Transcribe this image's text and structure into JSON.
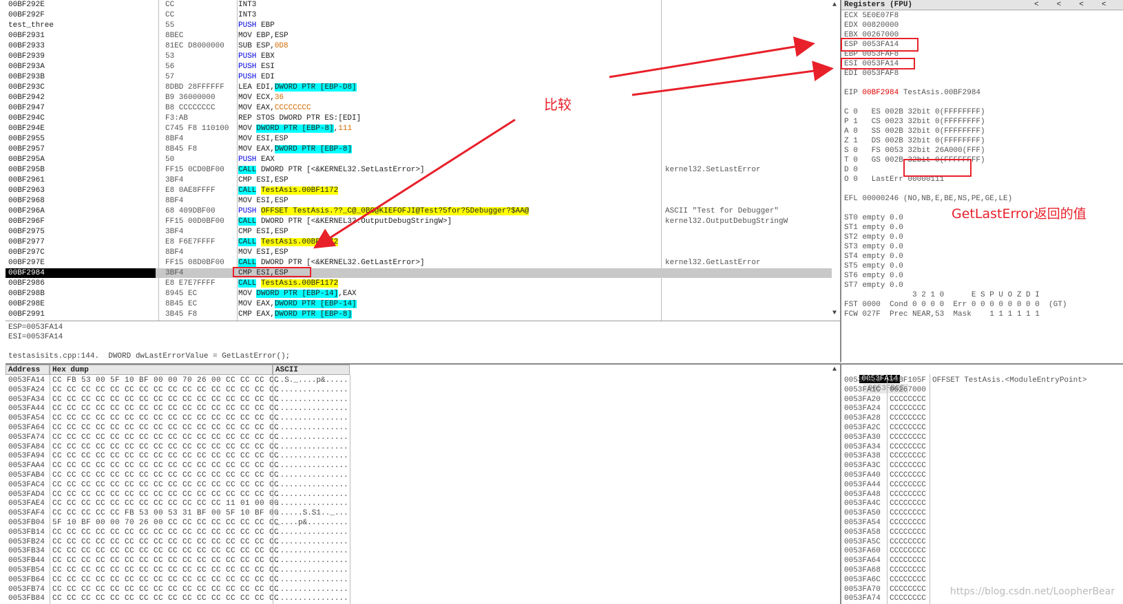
{
  "disasm": {
    "rows": [
      {
        "addr": "00BF292E",
        "hex": "CC",
        "mn": "INT3",
        "ops": ""
      },
      {
        "addr": "00BF292F",
        "hex": "CC",
        "mn": "INT3",
        "ops": ""
      },
      {
        "addr": "test_three",
        "hex": "55",
        "mn": "PUSH",
        "ops": " EBP",
        "mnClass": "mn-blue"
      },
      {
        "addr": "00BF2931",
        "hex": "8BEC",
        "mn": "MOV",
        "ops": " EBP,ESP"
      },
      {
        "addr": "00BF2933",
        "hex": "81EC D8000000",
        "mn": "SUB",
        "ops": " ESP,",
        "num": "0D8"
      },
      {
        "addr": "00BF2939",
        "hex": "53",
        "mn": "PUSH",
        "ops": " EBX",
        "mnClass": "mn-blue"
      },
      {
        "addr": "00BF293A",
        "hex": "56",
        "mn": "PUSH",
        "ops": " ESI",
        "mnClass": "mn-blue"
      },
      {
        "addr": "00BF293B",
        "hex": "57",
        "mn": "PUSH",
        "ops": " EDI",
        "mnClass": "mn-blue"
      },
      {
        "addr": "00BF293C",
        "hex": "8DBD 28FFFFFF",
        "mn": "LEA",
        "ops": " EDI,",
        "hl": "DWORD PTR [EBP-D8]"
      },
      {
        "addr": "00BF2942",
        "hex": "B9 36000000",
        "mn": "MOV",
        "ops": " ECX,",
        "num": "36"
      },
      {
        "addr": "00BF2947",
        "hex": "B8 CCCCCCCC",
        "mn": "MOV",
        "ops": " EAX,",
        "num": "CCCCCCCC"
      },
      {
        "addr": "00BF294C",
        "hex": "F3:AB",
        "mn": "REP STOS",
        "ops": " DWORD PTR ES:[EDI]"
      },
      {
        "addr": "00BF294E",
        "hex": "C745 F8 110100",
        "mn": "MOV",
        "ops": " ",
        "hl": "DWORD PTR [EBP-8]",
        "ops2": ",",
        "num2": "111"
      },
      {
        "addr": "00BF2955",
        "hex": "8BF4",
        "mn": "MOV",
        "ops": " ESI,ESP"
      },
      {
        "addr": "00BF2957",
        "hex": "8B45 F8",
        "mn": "MOV",
        "ops": " EAX,",
        "hl": "DWORD PTR [EBP-8]"
      },
      {
        "addr": "00BF295A",
        "hex": "50",
        "mn": "PUSH",
        "ops": " EAX",
        "mnClass": "mn-blue"
      },
      {
        "addr": "00BF295B",
        "hex": "FF15 0CD0BF00",
        "mn": "CALL",
        "ops": " DWORD PTR [<&KERNEL32.SetLastError>]",
        "mnHl": "hl-cyan",
        "com": "kernel32.SetLastError"
      },
      {
        "addr": "00BF2961",
        "hex": "3BF4",
        "mn": "CMP",
        "ops": " ESI,ESP"
      },
      {
        "addr": "00BF2963",
        "hex": "E8 0AE8FFFF",
        "mn": "CALL",
        "ops": " ",
        "mnHl": "hl-cyan",
        "yl": "TestAsis.00BF1172"
      },
      {
        "addr": "00BF2968",
        "hex": "8BF4",
        "mn": "MOV",
        "ops": " ESI,ESP"
      },
      {
        "addr": "00BF296A",
        "hex": "68 409DBF00",
        "mn": "PUSH",
        "ops": " ",
        "mnClass": "mn-blue",
        "yl": "OFFSET TestAsis.??_C@_0BC@KIEFOFJI@Test?5for?5Debugger?$AA@",
        "com": "ASCII \"Test for Debugger\""
      },
      {
        "addr": "00BF296F",
        "hex": "FF15 00D0BF00",
        "mn": "CALL",
        "ops": " DWORD PTR [<&KERNEL32.OutputDebugStringW>]",
        "mnHl": "hl-cyan",
        "com": "kernel32.OutputDebugStringW"
      },
      {
        "addr": "00BF2975",
        "hex": "3BF4",
        "mn": "CMP",
        "ops": " ESI,ESP"
      },
      {
        "addr": "00BF2977",
        "hex": "E8 F6E7FFFF",
        "mn": "CALL",
        "ops": " ",
        "mnHl": "hl-cyan",
        "yl": "TestAsis.00BF1172"
      },
      {
        "addr": "00BF297C",
        "hex": "8BF4",
        "mn": "MOV",
        "ops": " ESI,ESP"
      },
      {
        "addr": "00BF297E",
        "hex": "FF15 08D0BF00",
        "mn": "CALL",
        "ops": " DWORD PTR [<&KERNEL32.GetLastError>]",
        "mnHl": "hl-cyan",
        "com": "kernel32.GetLastError"
      },
      {
        "addr": "00BF2984",
        "hex": "3BF4",
        "mn": "CMP",
        "ops": " ESI,ESP",
        "sel": true
      },
      {
        "addr": "00BF2986",
        "hex": "E8 E7E7FFFF",
        "mn": "CALL",
        "ops": " ",
        "mnHl": "hl-cyan",
        "yl": "TestAsis.00BF1172"
      },
      {
        "addr": "00BF298B",
        "hex": "8945 EC",
        "mn": "MOV",
        "ops": " ",
        "hl": "DWORD PTR [EBP-14]",
        "ops2": ",EAX"
      },
      {
        "addr": "00BF298E",
        "hex": "8B45 EC",
        "mn": "MOV",
        "ops": " EAX,",
        "hl": "DWORD PTR [EBP-14]"
      },
      {
        "addr": "00BF2991",
        "hex": "3B45 F8",
        "mn": "CMP",
        "ops": " EAX,",
        "hl": "DWORD PTR [EBP-8]"
      }
    ]
  },
  "info": {
    "line1": "ESP=0053FA14",
    "line2": "ESI=0053FA14",
    "line3": "testasisits.cpp:144.  DWORD dwLastErrorValue = GetLastError();"
  },
  "registers": {
    "title": "Registers (FPU)",
    "nav": [
      "<",
      "<",
      "<",
      "<"
    ],
    "lines": [
      "ECX 5E0E07F8",
      "EDX 00820000",
      "EBX 00267000",
      "ESP 0053FA14",
      "EBP 0053FAF8",
      "ESI 0053FA14",
      "EDI 0053FAF8",
      "",
      "EIP ",
      "",
      "C 0   ES 002B 32bit 0(FFFFFFFF)",
      "P 1   CS 0023 32bit 0(FFFFFFFF)",
      "A 0   SS 002B 32bit 0(FFFFFFFF)",
      "Z 1   DS 002B 32bit 0(FFFFFFFF)",
      "S 0   FS 0053 32bit 26A000(FFF)",
      "T 0   GS 002B 32bit 0(FFFFFFFF)",
      "D 0",
      "O 0   LastErr 00000111",
      "",
      "EFL 00000246 (NO,NB,E,BE,NS,PE,GE,LE)",
      "",
      "ST0 empty 0.0",
      "ST1 empty 0.0",
      "ST2 empty 0.0",
      "ST3 empty 0.0",
      "ST4 empty 0.0",
      "ST5 empty 0.0",
      "ST6 empty 0.0",
      "ST7 empty 0.0",
      "               3 2 1 0      E S P U O Z D I",
      "FST 0000  Cond 0 0 0 0  Err 0 0 0 0 0 0 0 0  (GT)",
      "FCW 027F  Prec NEAR,53  Mask    1 1 1 1 1 1"
    ],
    "eip_val": "00BF2984",
    "eip_rest": " TestAsis.00BF2984"
  },
  "annotations": {
    "compare": "比较",
    "lasterr": "GetLastError返回的值"
  },
  "dump": {
    "col_address": "Address",
    "col_hex": "Hex dump",
    "col_ascii": "ASCII",
    "rows": [
      [
        "0053FA14",
        "CC FB 53 00 5F 10 BF 00 00 70 26 00 CC CC CC CC",
        "..S._....p&....."
      ],
      [
        "0053FA24",
        "CC CC CC CC CC CC CC CC CC CC CC CC CC CC CC CC",
        "................"
      ],
      [
        "0053FA34",
        "CC CC CC CC CC CC CC CC CC CC CC CC CC CC CC CC",
        "................"
      ],
      [
        "0053FA44",
        "CC CC CC CC CC CC CC CC CC CC CC CC CC CC CC CC",
        "................"
      ],
      [
        "0053FA54",
        "CC CC CC CC CC CC CC CC CC CC CC CC CC CC CC CC",
        "................"
      ],
      [
        "0053FA64",
        "CC CC CC CC CC CC CC CC CC CC CC CC CC CC CC CC",
        "................"
      ],
      [
        "0053FA74",
        "CC CC CC CC CC CC CC CC CC CC CC CC CC CC CC CC",
        "................"
      ],
      [
        "0053FA84",
        "CC CC CC CC CC CC CC CC CC CC CC CC CC CC CC CC",
        "................"
      ],
      [
        "0053FA94",
        "CC CC CC CC CC CC CC CC CC CC CC CC CC CC CC CC",
        "................"
      ],
      [
        "0053FAA4",
        "CC CC CC CC CC CC CC CC CC CC CC CC CC CC CC CC",
        "................"
      ],
      [
        "0053FAB4",
        "CC CC CC CC CC CC CC CC CC CC CC CC CC CC CC CC",
        "................"
      ],
      [
        "0053FAC4",
        "CC CC CC CC CC CC CC CC CC CC CC CC CC CC CC CC",
        "................"
      ],
      [
        "0053FAD4",
        "CC CC CC CC CC CC CC CC CC CC CC CC CC CC CC CC",
        "................"
      ],
      [
        "0053FAE4",
        "CC CC CC CC CC CC CC CC CC CC CC CC 11 01 00 00",
        "................"
      ],
      [
        "0053FAF4",
        "CC CC CC CC CC FB 53 00 53 31 BF 00 5F 10 BF 00",
        "......S.S1.._..."
      ],
      [
        "0053FB04",
        "5F 10 BF 00 00 70 26 00 CC CC CC CC CC CC CC CC",
        "_....p&........."
      ],
      [
        "0053FB14",
        "CC CC CC CC CC CC CC CC CC CC CC CC CC CC CC CC",
        "................"
      ],
      [
        "0053FB24",
        "CC CC CC CC CC CC CC CC CC CC CC CC CC CC CC CC",
        "................"
      ],
      [
        "0053FB34",
        "CC CC CC CC CC CC CC CC CC CC CC CC CC CC CC CC",
        "................"
      ],
      [
        "0053FB44",
        "CC CC CC CC CC CC CC CC CC CC CC CC CC CC CC CC",
        "................"
      ],
      [
        "0053FB54",
        "CC CC CC CC CC CC CC CC CC CC CC CC CC CC CC CC",
        "................"
      ],
      [
        "0053FB64",
        "CC CC CC CC CC CC CC CC CC CC CC CC CC CC CC CC",
        "................"
      ],
      [
        "0053FB74",
        "CC CC CC CC CC CC CC CC CC CC CC CC CC CC CC CC",
        "................"
      ],
      [
        "0053FB84",
        "CC CC CC CC CC CC CC CC CC CC CC CC CC CC CC CC",
        "................"
      ]
    ]
  },
  "stack": {
    "header_addr": "0053FA14",
    "header_val": "0053FBCC",
    "rows": [
      [
        "0053FA18",
        "00BF105F",
        "OFFSET TestAsis.<ModuleEntryPoint>"
      ],
      [
        "0053FA1C",
        "00267000",
        ""
      ],
      [
        "0053FA20",
        "CCCCCCCC",
        ""
      ],
      [
        "0053FA24",
        "CCCCCCCC",
        ""
      ],
      [
        "0053FA28",
        "CCCCCCCC",
        ""
      ],
      [
        "0053FA2C",
        "CCCCCCCC",
        ""
      ],
      [
        "0053FA30",
        "CCCCCCCC",
        ""
      ],
      [
        "0053FA34",
        "CCCCCCCC",
        ""
      ],
      [
        "0053FA38",
        "CCCCCCCC",
        ""
      ],
      [
        "0053FA3C",
        "CCCCCCCC",
        ""
      ],
      [
        "0053FA40",
        "CCCCCCCC",
        ""
      ],
      [
        "0053FA44",
        "CCCCCCCC",
        ""
      ],
      [
        "0053FA48",
        "CCCCCCCC",
        ""
      ],
      [
        "0053FA4C",
        "CCCCCCCC",
        ""
      ],
      [
        "0053FA50",
        "CCCCCCCC",
        ""
      ],
      [
        "0053FA54",
        "CCCCCCCC",
        ""
      ],
      [
        "0053FA58",
        "CCCCCCCC",
        ""
      ],
      [
        "0053FA5C",
        "CCCCCCCC",
        ""
      ],
      [
        "0053FA60",
        "CCCCCCCC",
        ""
      ],
      [
        "0053FA64",
        "CCCCCCCC",
        ""
      ],
      [
        "0053FA68",
        "CCCCCCCC",
        ""
      ],
      [
        "0053FA6C",
        "CCCCCCCC",
        ""
      ],
      [
        "0053FA70",
        "CCCCCCCC",
        ""
      ],
      [
        "0053FA74",
        "CCCCCCCC",
        ""
      ]
    ]
  },
  "watermark": "https://blog.csdn.net/LoopherBear",
  "colors": {
    "annotation": "#e8202a",
    "cyan": "#00ffff",
    "yellow": "#ffff00"
  }
}
